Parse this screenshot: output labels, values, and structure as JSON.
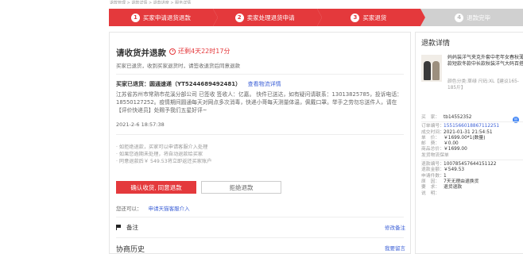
{
  "topline": "退款管理 > 退款详情 > 退款进度 > 服务详情",
  "steps": [
    {
      "num": "1",
      "label": "买家申请退货退款"
    },
    {
      "num": "2",
      "label": "卖家处理退货申请"
    },
    {
      "num": "3",
      "label": "买家退货"
    },
    {
      "num": "4",
      "label": "退款完毕"
    }
  ],
  "main": {
    "title": "请收货并退款",
    "countdown": "还剩4天22时17分",
    "subtitle": "买家已退货，收到买家退货时，请签收退货后同意退款",
    "ship_label": "买家已退货：圆通速递（YT5244689492481）",
    "ship_link": "查看物流详情",
    "track_text": "江苏省苏州市常熟市花溪分部公司 已签收 签收人：亿嘉。 快件已送达，如有疑问请联系：13013825785，投诉电话：18550127252。疫情期间圆通每天对网点多次消毒，快递小哥每天测量体温，佩戴口罩。举手之劳勿忘送件人，请在【评价快递员】处赐予我们五星好评~",
    "track_date": "2021-2-6 18:57:38",
    "notes": [
      "· 如拒绝退款，买家可以申请客服介入处理",
      "· 如果您逾期未处理，将自动退款给买家",
      "· 同意退款后￥ 549.53将立即返还买家账户"
    ],
    "confirm_btn": "确认收货, 同意退款",
    "reject_btn": "拒绝退款",
    "also_label": "您还可以：",
    "also_link": "申请天猫客服介入",
    "note_label": "备注",
    "note_link": "修改备注",
    "history_label": "协商历史",
    "history_link": "我要留言"
  },
  "side": {
    "title": "退款详情",
    "product_name": "妈妈装洋气夹克外套中老年女春秋薄款短款冬款中长款秋装洋气大码百搭",
    "product_sku": "颜色分类:草绿 尺码:XL【建议165-185斤】",
    "info": [
      {
        "k": "买　家：",
        "v": "tb14552352",
        "cls": ""
      },
      {
        "k": "订单编号：",
        "v": "1551566018867112251",
        "cls": "blue"
      },
      {
        "k": "成交时间：",
        "v": "2021-01-31 21:54:51",
        "cls": ""
      },
      {
        "k": "单　价：",
        "v": "￥1699.00*1(数量)",
        "cls": ""
      },
      {
        "k": "邮　费：",
        "v": "￥0.00",
        "cls": ""
      },
      {
        "k": "商品总价：",
        "v": "￥1699.00",
        "cls": ""
      },
      {
        "k": "发货物流保单",
        "v": "",
        "cls": ""
      },
      {
        "k": "退款编号：",
        "v": "100785457644151122",
        "cls": ""
      },
      {
        "k": "退款金额：",
        "v": "￥549.53",
        "cls": ""
      },
      {
        "k": "申请件数：",
        "v": "1",
        "cls": ""
      },
      {
        "k": "原　因：",
        "v": "7天无理由退换货",
        "cls": ""
      },
      {
        "k": "要　求：",
        "v": "退货退款",
        "cls": ""
      },
      {
        "k": "说　明：",
        "v": "",
        "cls": ""
      }
    ]
  },
  "colors": {
    "accent": "#e4393c",
    "link": "#3b5fd6",
    "inactive": "#d0d0d0"
  }
}
